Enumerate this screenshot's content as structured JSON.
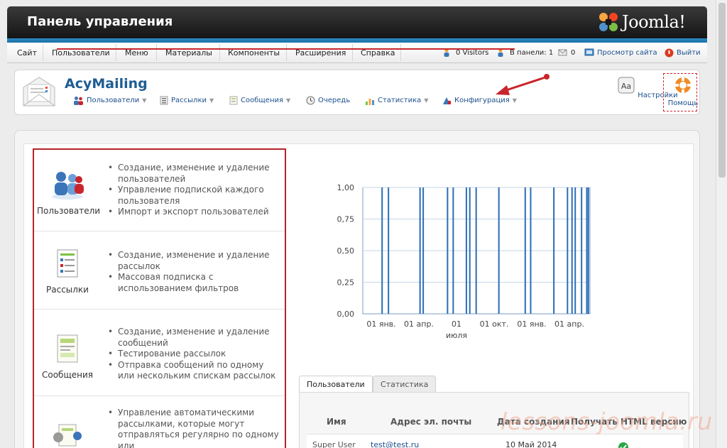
{
  "header": {
    "title": "Панель управления",
    "logo_text": "Joomla!"
  },
  "menu": {
    "items": [
      "Сайт",
      "Пользователи",
      "Меню",
      "Материалы",
      "Компоненты",
      "Расширения",
      "Справка"
    ],
    "status": {
      "visitors": "0 Visitors",
      "admins": "В панели: 1",
      "messages": "0",
      "preview": "Просмотр сайта",
      "logout": "Выйти"
    }
  },
  "toolbar": {
    "title": "AcyMailing",
    "submenu": [
      {
        "label": "Пользователи",
        "has_dropdown": true
      },
      {
        "label": "Рассылки",
        "has_dropdown": true
      },
      {
        "label": "Сообщения",
        "has_dropdown": true
      },
      {
        "label": "Очередь",
        "has_dropdown": false
      },
      {
        "label": "Статистика",
        "has_dropdown": true
      },
      {
        "label": "Конфигурация",
        "has_dropdown": true
      }
    ],
    "buttons": {
      "settings": "Настройки",
      "help": "Помощь"
    }
  },
  "features": [
    {
      "label": "Пользователи",
      "bullets": [
        "Создание, изменение и удаление пользователей",
        "Управление подпиской каждого пользователя",
        "Импорт и экспорт пользователей"
      ]
    },
    {
      "label": "Рассылки",
      "bullets": [
        "Создание, изменение и удаление рассылок",
        "Массовая подписка с использованием фильтров"
      ]
    },
    {
      "label": "Сообщения",
      "bullets": [
        "Создание, изменение и удаление сообщений",
        "Тестирование рассылок",
        "Отправка сообщений по одному или нескольким спискам рассылок"
      ]
    },
    {
      "label": "",
      "bullets": [
        "Управление автоматическими рассылками, которые могут отправляться регулярно по одному или"
      ]
    }
  ],
  "chart_data": {
    "type": "bar",
    "y_ticks": [
      "1,00",
      "0,75",
      "0,50",
      "0,25",
      "0,00"
    ],
    "ylim": [
      0,
      1
    ],
    "x_ticks": [
      "01 янв.",
      "01 апр.",
      "01 июля",
      "01 окт.",
      "01 янв.",
      "01 апр."
    ],
    "x_tick_lines": [
      [
        "01 янв."
      ],
      [
        "01 апр."
      ],
      [
        "01",
        "июля"
      ],
      [
        "01 окт."
      ],
      [
        "01 янв."
      ],
      [
        "01 апр."
      ]
    ],
    "x_range": [
      0,
      100
    ],
    "bars": [
      {
        "x": 8.5,
        "value": 1
      },
      {
        "x": 11.3,
        "value": 1
      },
      {
        "x": 25.2,
        "value": 1
      },
      {
        "x": 26.6,
        "value": 1
      },
      {
        "x": 37.3,
        "value": 1
      },
      {
        "x": 39.8,
        "value": 1
      },
      {
        "x": 45.6,
        "value": 1
      },
      {
        "x": 47.1,
        "value": 1
      },
      {
        "x": 49.9,
        "value": 1
      },
      {
        "x": 59.9,
        "value": 1
      },
      {
        "x": 71.5,
        "value": 1
      },
      {
        "x": 73.9,
        "value": 1
      },
      {
        "x": 84.1,
        "value": 1
      },
      {
        "x": 90.1,
        "value": 1
      },
      {
        "x": 92.1,
        "value": 1
      },
      {
        "x": 93.5,
        "value": 1
      },
      {
        "x": 96.3,
        "value": 1
      },
      {
        "x": 98.6,
        "value": 1
      },
      {
        "x": 99.3,
        "value": 1
      }
    ],
    "colors": {
      "bar": "#2a6db6",
      "grid": "#c6d6e8",
      "axis": "#7f9ec4"
    }
  },
  "tabs": [
    {
      "label": "Пользователи",
      "active": true
    },
    {
      "label": "Статистика",
      "active": false
    }
  ],
  "table": {
    "headers": [
      "Имя",
      "Адрес эл. почты",
      "Дата создания",
      "Получать HTML версию"
    ],
    "rows": [
      {
        "name": "Super User",
        "email": "test@test.ru",
        "date": "10 Май 2014",
        "html": "check"
      }
    ]
  },
  "watermark": "lessons-joomla.ru"
}
